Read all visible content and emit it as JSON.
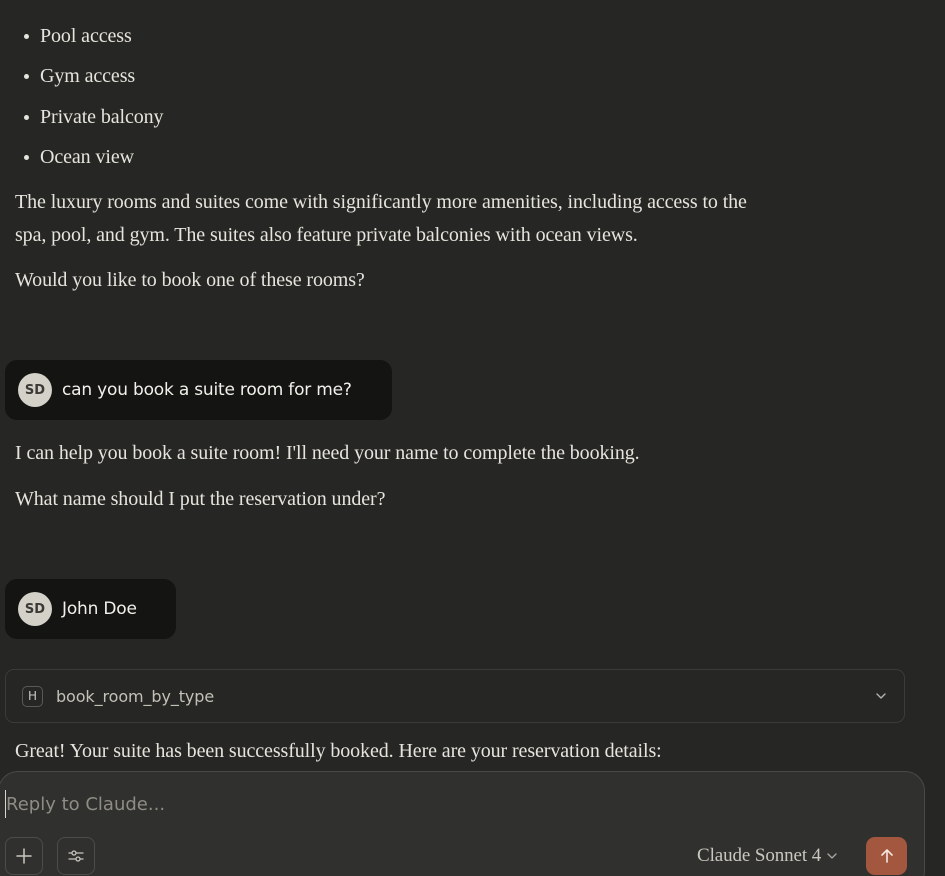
{
  "amenity_bullets": [
    "Pool access",
    "Gym access",
    "Private balcony",
    "Ocean view"
  ],
  "assistant_msg_1": {
    "line1": "The luxury rooms and suites come with significantly more amenities, including access to the",
    "line2": "spa, pool, and gym. The suites also feature private balconies with ocean views.",
    "question": "Would you like to book one of these rooms?"
  },
  "user_msg_1": {
    "avatar": "SD",
    "text": "can you book a suite room for me?"
  },
  "assistant_msg_2": {
    "line1": "I can help you book a suite room! I'll need your name to complete the booking.",
    "line2": "What name should I put the reservation under?"
  },
  "user_msg_2": {
    "avatar": "SD",
    "text": "John Doe"
  },
  "tool_call": {
    "badge": "H",
    "name": "book_room_by_type",
    "icon": "chevron-down-icon"
  },
  "assistant_msg_3": {
    "line1": "Great! Your suite has been successfully booked. Here are your reservation details:"
  },
  "composer": {
    "placeholder": "Reply to Claude...",
    "value": "",
    "add_icon": "plus-icon",
    "tools_icon": "sliders-icon",
    "model": "Claude Sonnet 4",
    "send_icon": "arrow-up-icon"
  },
  "colors": {
    "background": "#262624",
    "user_bubble": "#141413",
    "send_button": "#a3573e",
    "composer": "#30302e"
  }
}
